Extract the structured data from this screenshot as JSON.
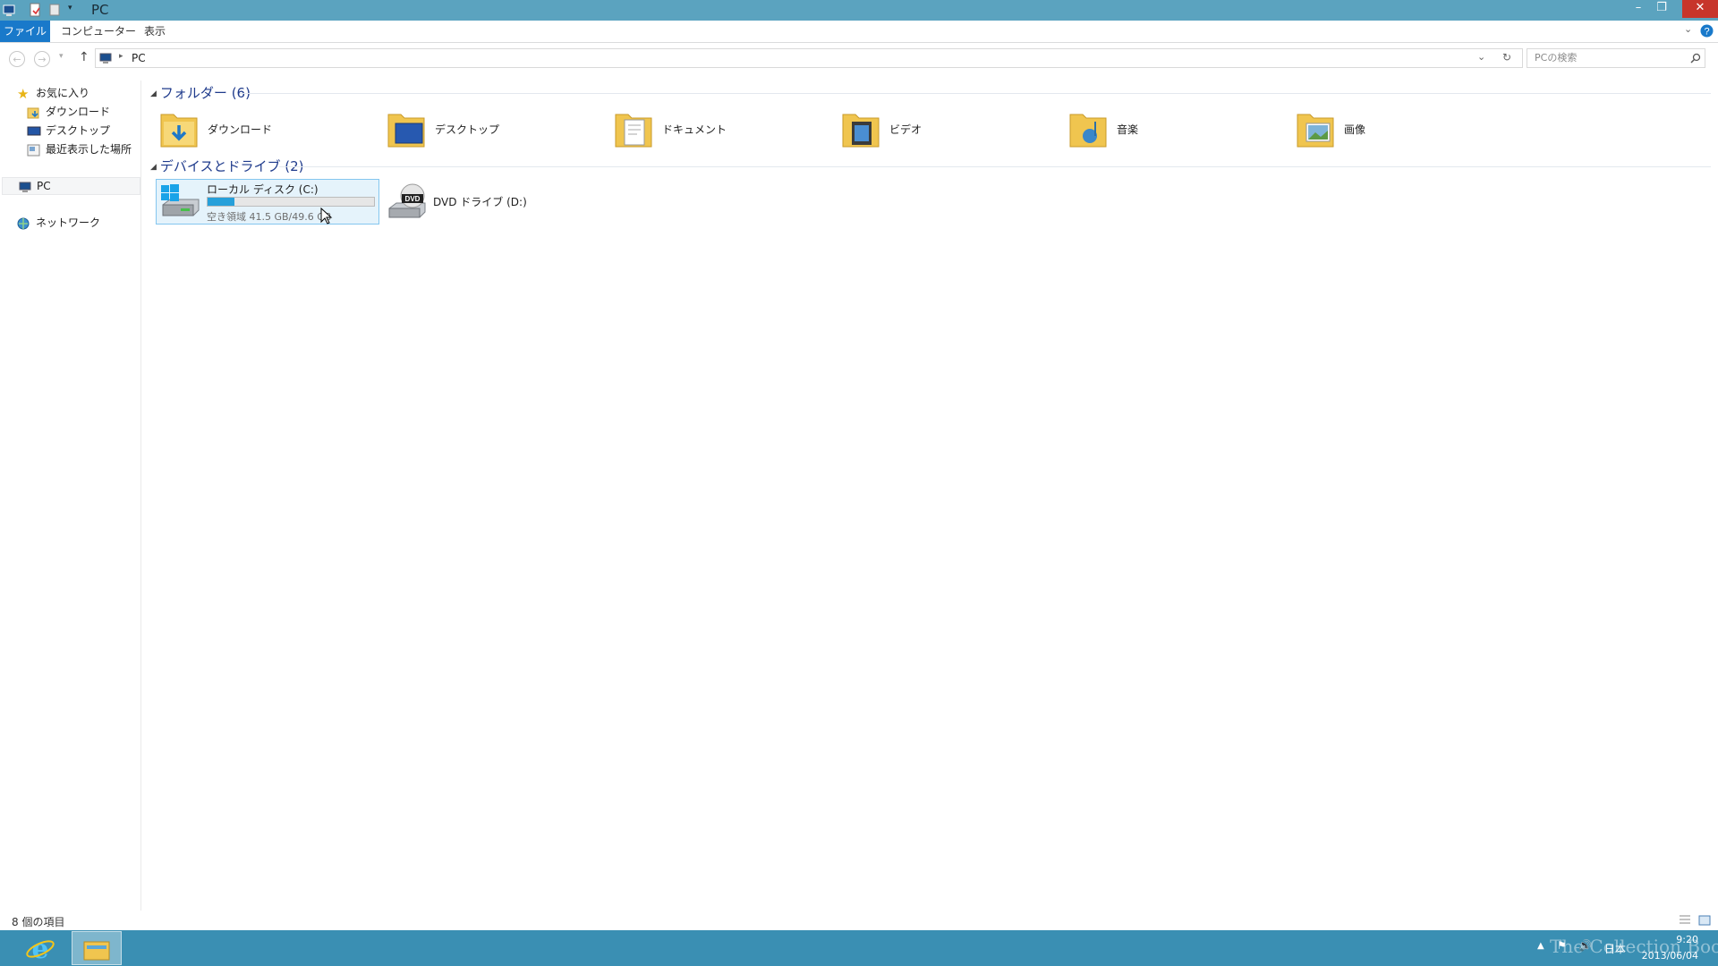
{
  "window": {
    "title": "PC",
    "controls": {
      "minimize": "–",
      "restore": "❐",
      "close": "✕"
    }
  },
  "ribbon": {
    "tabs": [
      {
        "label": "ファイル",
        "active": true
      },
      {
        "label": "コンピューター"
      },
      {
        "label": "表示"
      }
    ],
    "expand_icon": "chevron-down-icon",
    "help_icon": "help-icon"
  },
  "address": {
    "location": "PC",
    "search_placeholder": "PCの検索"
  },
  "navpane": {
    "favorites": {
      "label": "お気に入り",
      "items": [
        {
          "label": "ダウンロード",
          "icon": "download-folder-icon"
        },
        {
          "label": "デスクトップ",
          "icon": "desktop-icon"
        },
        {
          "label": "最近表示した場所",
          "icon": "recent-places-icon"
        }
      ]
    },
    "pc": {
      "label": "PC"
    },
    "network": {
      "label": "ネットワーク"
    }
  },
  "content": {
    "folders_group": {
      "label": "フォルダー (6)"
    },
    "folders": [
      {
        "label": "ダウンロード",
        "icon": "downloads-folder-icon"
      },
      {
        "label": "デスクトップ",
        "icon": "desktop-folder-icon"
      },
      {
        "label": "ドキュメント",
        "icon": "documents-folder-icon"
      },
      {
        "label": "ビデオ",
        "icon": "videos-folder-icon"
      },
      {
        "label": "音楽",
        "icon": "music-folder-icon"
      },
      {
        "label": "画像",
        "icon": "pictures-folder-icon"
      }
    ],
    "drives_group": {
      "label": "デバイスとドライブ (2)"
    },
    "drives": [
      {
        "label": "ローカル ディスク (C:)",
        "free": "空き領域 41.5 GB/49.6 GB",
        "used_fraction": 0.163,
        "selected": true
      },
      {
        "label": "DVD ドライブ (D:)"
      }
    ]
  },
  "status": {
    "item_count": "8 個の項目"
  },
  "taskbar": {
    "apps": [
      "internet-explorer-icon",
      "file-explorer-icon"
    ],
    "language": "日本",
    "time": "9:20",
    "date": "2013/06/04",
    "watermark": "The Collection Book"
  },
  "colors": {
    "titlebar": "#5ba3bf",
    "taskbar": "#3a8fb3",
    "accent": "#1979ca",
    "selection": "#e5f3fb",
    "progress": "#26a0da",
    "group_header": "#1f3b8c"
  }
}
